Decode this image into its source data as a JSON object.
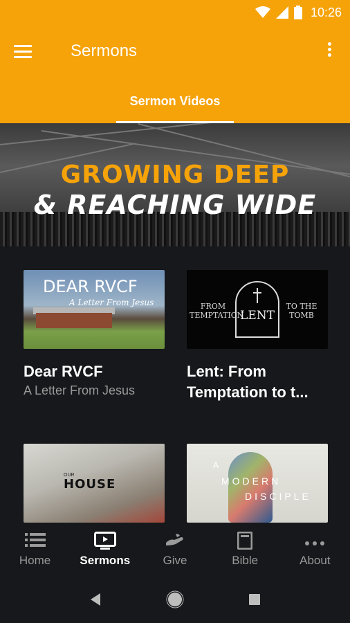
{
  "status_bar": {
    "time": "10:26"
  },
  "app_bar": {
    "title": "Sermons"
  },
  "tabs": [
    {
      "label": "Sermon Videos",
      "selected": true
    }
  ],
  "hero": {
    "line1": "GROWING DEEP",
    "line2": "& REACHING WIDE"
  },
  "cards": [
    {
      "title": "Dear RVCF",
      "subtitle": "A Letter From Jesus",
      "thumb": {
        "title": "DEAR RVCF",
        "sub": "A Letter From Jesus"
      }
    },
    {
      "title": "Lent: From Temptation to t...",
      "subtitle": "",
      "thumb": {
        "left": "FROM TEMPTATION",
        "center": "LENT",
        "right": "TO THE TOMB"
      }
    },
    {
      "title": "",
      "subtitle": "",
      "thumb": {
        "small": "OUR",
        "big": "HOUSE"
      }
    },
    {
      "title": "",
      "subtitle": "",
      "thumb": {
        "w1": "A",
        "w2": "MODERN",
        "w3": "DISCIPLE"
      }
    }
  ],
  "bottom_nav": [
    {
      "label": "Home",
      "icon": "list-icon"
    },
    {
      "label": "Sermons",
      "icon": "tv-icon",
      "active": true
    },
    {
      "label": "Give",
      "icon": "hand-icon"
    },
    {
      "label": "Bible",
      "icon": "book-icon"
    },
    {
      "label": "About",
      "icon": "more-horiz-icon"
    }
  ],
  "colors": {
    "accent": "#f6a30a",
    "background": "#16181b",
    "muted": "#9a9a9a"
  }
}
